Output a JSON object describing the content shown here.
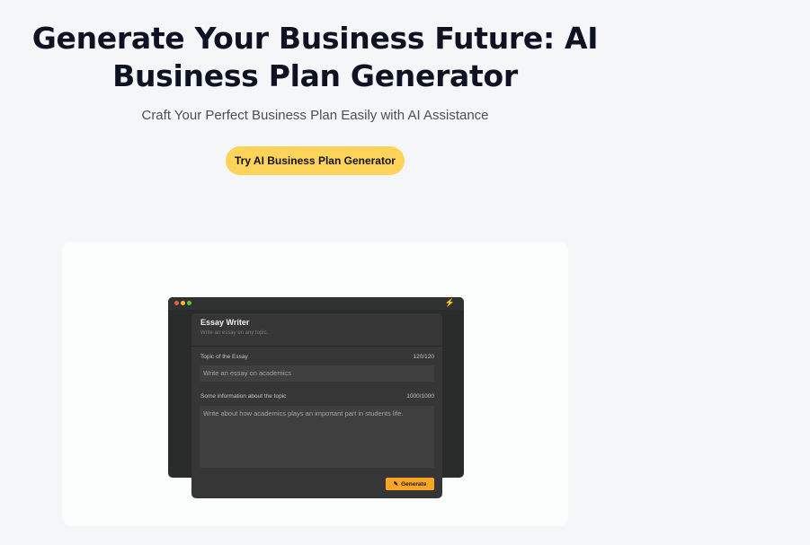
{
  "hero": {
    "title_line1": "Generate Your Business Future: AI",
    "title_line2": "Business Plan Generator",
    "subtitle": "Craft Your Perfect Business Plan Easily with AI Assistance",
    "cta_label": "Try AI Business Plan Generator",
    "cta_color": "#fdd35a"
  },
  "preview": {
    "window_icon": "bolt-icon",
    "panel": {
      "title": "Essay Writer",
      "description": "Write an essay on any topic.",
      "fields": [
        {
          "label": "Topic of the Essay",
          "count": "120/120",
          "value": "Write an essay on academics"
        },
        {
          "label": "Some information about the topic",
          "count": "1000/1000",
          "value": "Write about how academics plays an important part in students life."
        }
      ],
      "generate_label": "Generate",
      "generate_icon": "magic-wand-icon",
      "accent_color": "#f6a623"
    }
  }
}
